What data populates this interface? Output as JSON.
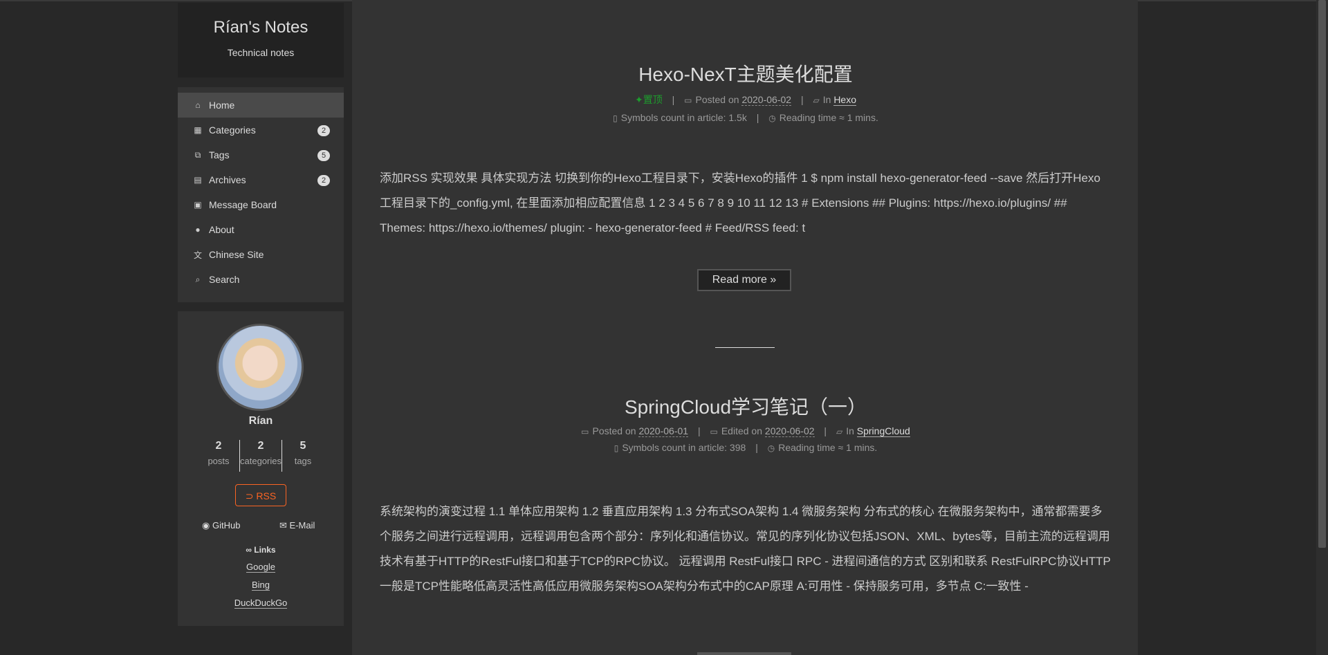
{
  "site": {
    "title": "Rían's Notes",
    "subtitle": "Technical notes"
  },
  "menu": [
    {
      "label": "Home",
      "icon": "home-icon",
      "glyph": "⌂",
      "badge": ""
    },
    {
      "label": "Categories",
      "icon": "th-icon",
      "glyph": "▦",
      "badge": "2"
    },
    {
      "label": "Tags",
      "icon": "tags-icon",
      "glyph": "⧉",
      "badge": "5"
    },
    {
      "label": "Archives",
      "icon": "archive-icon",
      "glyph": "▤",
      "badge": "2"
    },
    {
      "label": "Message Board",
      "icon": "message-icon",
      "glyph": "▣",
      "badge": ""
    },
    {
      "label": "About",
      "icon": "user-icon",
      "glyph": "●",
      "badge": ""
    },
    {
      "label": "Chinese Site",
      "icon": "language-icon",
      "glyph": "文",
      "badge": ""
    },
    {
      "label": "Search",
      "icon": "search-icon",
      "glyph": "⌕",
      "badge": ""
    }
  ],
  "author": {
    "name": "Rían",
    "stats": [
      {
        "num": "2",
        "label": "posts"
      },
      {
        "num": "2",
        "label": "categories"
      },
      {
        "num": "5",
        "label": "tags"
      }
    ],
    "rss_label": "RSS",
    "social": {
      "github": "GitHub",
      "email": "E-Mail"
    },
    "links_title": "Links",
    "links": [
      "Google",
      "Bing",
      "DuckDuckGo"
    ]
  },
  "posts": [
    {
      "title": "Hexo-NexT主题美化配置",
      "pinned": "置顶",
      "posted_label": "Posted on",
      "posted": "2020-06-02",
      "in_label": "In",
      "category": "Hexo",
      "symbols": "Symbols count in article: 1.5k",
      "reading": "Reading time ≈ 1 mins.",
      "excerpt": "添加RSS 实现效果 具体实现方法 切换到你的Hexo工程目录下，安装Hexo的插件 1 $ npm install hexo-generator-feed --save 然后打开Hexo工程目录下的_config.yml, 在里面添加相应配置信息  1 2 3 4 5 6 7 8 9 10 11 12 13 # Extensions ## Plugins: https://hexo.io/plugins/ ## Themes: https://hexo.io/themes/ plugin: - hexo-generator-feed # Feed/RSS feed: t",
      "read_more": "Read more »"
    },
    {
      "title": "SpringCloud学习笔记（一）",
      "posted_label": "Posted on",
      "posted": "2020-06-01",
      "edited_label": "Edited on",
      "edited": "2020-06-02",
      "in_label": "In",
      "category": "SpringCloud",
      "symbols": "Symbols count in article: 398",
      "reading": "Reading time ≈ 1 mins.",
      "excerpt": "系统架构的演变过程 1.1 单体应用架构 1.2 垂直应用架构 1.3 分布式SOA架构 1.4 微服务架构 分布式的核心 在微服务架构中，通常都需要多个服务之间进行远程调用，远程调用包含两个部分：序列化和通信协议。常见的序列化协议包括JSON、XML、bytes等，目前主流的远程调用技术有基于HTTP的RestFul接口和基于TCP的RPC协议。 远程调用 RestFul接口 RPC - 进程间通信的方式 区别和联系 RestFulRPC协议HTTP一般是TCP性能略低高灵活性高低应用微服务架构SOA架构分布式中的CAP原理 A:可用性 - 保持服务可用，多节点 C:一致性 -"
    }
  ]
}
